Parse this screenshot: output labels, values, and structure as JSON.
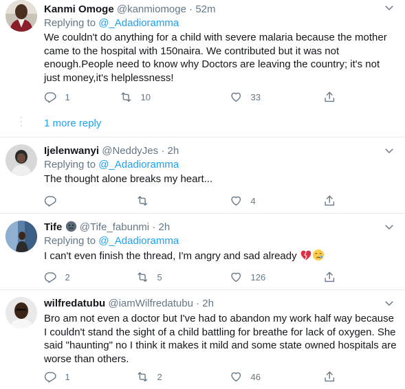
{
  "tweets": [
    {
      "name": "Kanmi Omoge",
      "handle": "@kanmiomoge",
      "dot": "·",
      "time": "52m",
      "replying_prefix": "Replying to ",
      "replying_to": "@_Adadioramma",
      "text": "We couldn't do anything for a child with severe malaria because the mother came to the hospital with 150naira. We contributed but it was not enough.People need to know why Doctors are leaving the country; it's not just money,it's helplessness!",
      "replies": "1",
      "retweets": "10",
      "likes": "33"
    },
    {
      "name": "Ijelenwanyi",
      "handle": "@NeddyJes",
      "dot": "·",
      "time": "2h",
      "replying_prefix": "Replying to ",
      "replying_to": "@_Adadioramma",
      "text": "The thought alone breaks my heart...",
      "replies": "",
      "retweets": "",
      "likes": "4"
    },
    {
      "name": "Tife",
      "handle": "@Tife_fabunmi",
      "dot": "·",
      "time": "2h",
      "replying_prefix": "Replying to ",
      "replying_to": "@_Adadioramma",
      "text": "I can't even finish the thread, I'm angry and sad already",
      "replies": "2",
      "retweets": "5",
      "likes": "126"
    },
    {
      "name": "wilfredatubu",
      "handle": "@iamWilfredatubu",
      "dot": "·",
      "time": "2h",
      "replying_prefix": "",
      "replying_to": "",
      "text": "Bro am not even a doctor but I've had to abandon my work half way because I couldn't stand the sight of a child battling for breathe for lack of oxygen. She said \"haunting\" no I think it makes it mild and some state owned hospitals are worse than others.",
      "replies": "1",
      "retweets": "2",
      "likes": "46"
    }
  ],
  "more_reply_label": "1 more reply",
  "colors": {
    "accent": "#1da1f2",
    "muted": "#657786",
    "text": "#14171a",
    "divider": "#e6ecf0"
  }
}
